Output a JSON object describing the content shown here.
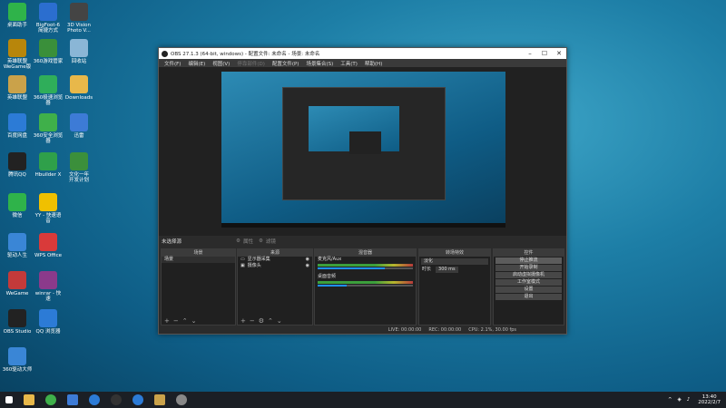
{
  "desktop": {
    "icons": [
      {
        "label": "桌面助手",
        "color": "#2fb34a"
      },
      {
        "label": "BigFoot-6\n简捷方式",
        "color": "#2b6ecf"
      },
      {
        "label": "3D Vision\nPhoto V...",
        "color": "#444"
      },
      {
        "label": "英雄联盟\nWeGame版",
        "color": "#b8860b"
      },
      {
        "label": "360游戏管家",
        "color": "#3a8f3a"
      },
      {
        "label": "回收站",
        "color": "#8ab6d6"
      },
      {
        "label": "英雄联盟",
        "color": "#caa24a"
      },
      {
        "label": "360极速浏览器",
        "color": "#2fae5a"
      },
      {
        "label": "Downloads",
        "color": "#e8b84a"
      },
      {
        "label": "百度网盘",
        "color": "#2c7bd6"
      },
      {
        "label": "360安全浏览器",
        "color": "#3fb04a"
      },
      {
        "label": "迅雷",
        "color": "#3d7bd6"
      },
      {
        "label": "腾讯QQ",
        "color": "#222"
      },
      {
        "label": "Hbuilder X",
        "color": "#2fa04a"
      },
      {
        "label": "文化一年\n开发计划",
        "color": "#3b8f3b"
      },
      {
        "label": "微信",
        "color": "#2fb34a"
      },
      {
        "label": "YY - 快速语\n音",
        "color": "#f0c000"
      },
      {
        "label": "驱动人生",
        "color": "#3a86d6"
      },
      {
        "label": "WPS Office",
        "color": "#d93a3a"
      },
      {
        "label": "WeGame",
        "color": "#c43a3a"
      },
      {
        "label": "winrar - 快\n速",
        "color": "#8b3a8b"
      },
      {
        "label": "OBS Studio",
        "color": "#222"
      },
      {
        "label": "QQ 浏览器",
        "color": "#2c7bd6"
      },
      {
        "label": "360驱动大师",
        "color": "#3a86d6"
      }
    ]
  },
  "obs": {
    "title": "OBS 27.1.3 (64-bit, windows) - 配置文件: 未命名 - 场景: 未命名",
    "menu": [
      "文件(F)",
      "编辑(E)",
      "视图(V)",
      "停靠部件(D)",
      "配置文件(P)",
      "场景集合(S)",
      "工具(T)",
      "帮助(H)"
    ],
    "source_bar": "未选择源",
    "props_btn": "属性",
    "filter_btn": "滤镜",
    "scenes": {
      "header": "场景",
      "items": [
        "场景"
      ]
    },
    "sources": {
      "header": "来源",
      "items": [
        "显示器采集",
        "摄像头"
      ]
    },
    "mixer": {
      "header": "混音器",
      "ch1": "麦克风/Aux",
      "ch2": "桌面音频"
    },
    "transitions": {
      "header": "转场特效",
      "type": "淡化",
      "dur_label": "时长",
      "dur_val": "300 ms"
    },
    "controls": {
      "header": "控件",
      "buttons": [
        "停止推流",
        "开始录制",
        "启动虚拟摄像机",
        "工作室模式",
        "设置",
        "退出"
      ]
    },
    "status": {
      "live": "LIVE: 00:00:00",
      "rec": "REC: 00:00:00",
      "cpu": "CPU: 2.1%, 30.00 fps"
    }
  },
  "taskbar": {
    "time": "13:40",
    "date": "2022/2/7"
  }
}
